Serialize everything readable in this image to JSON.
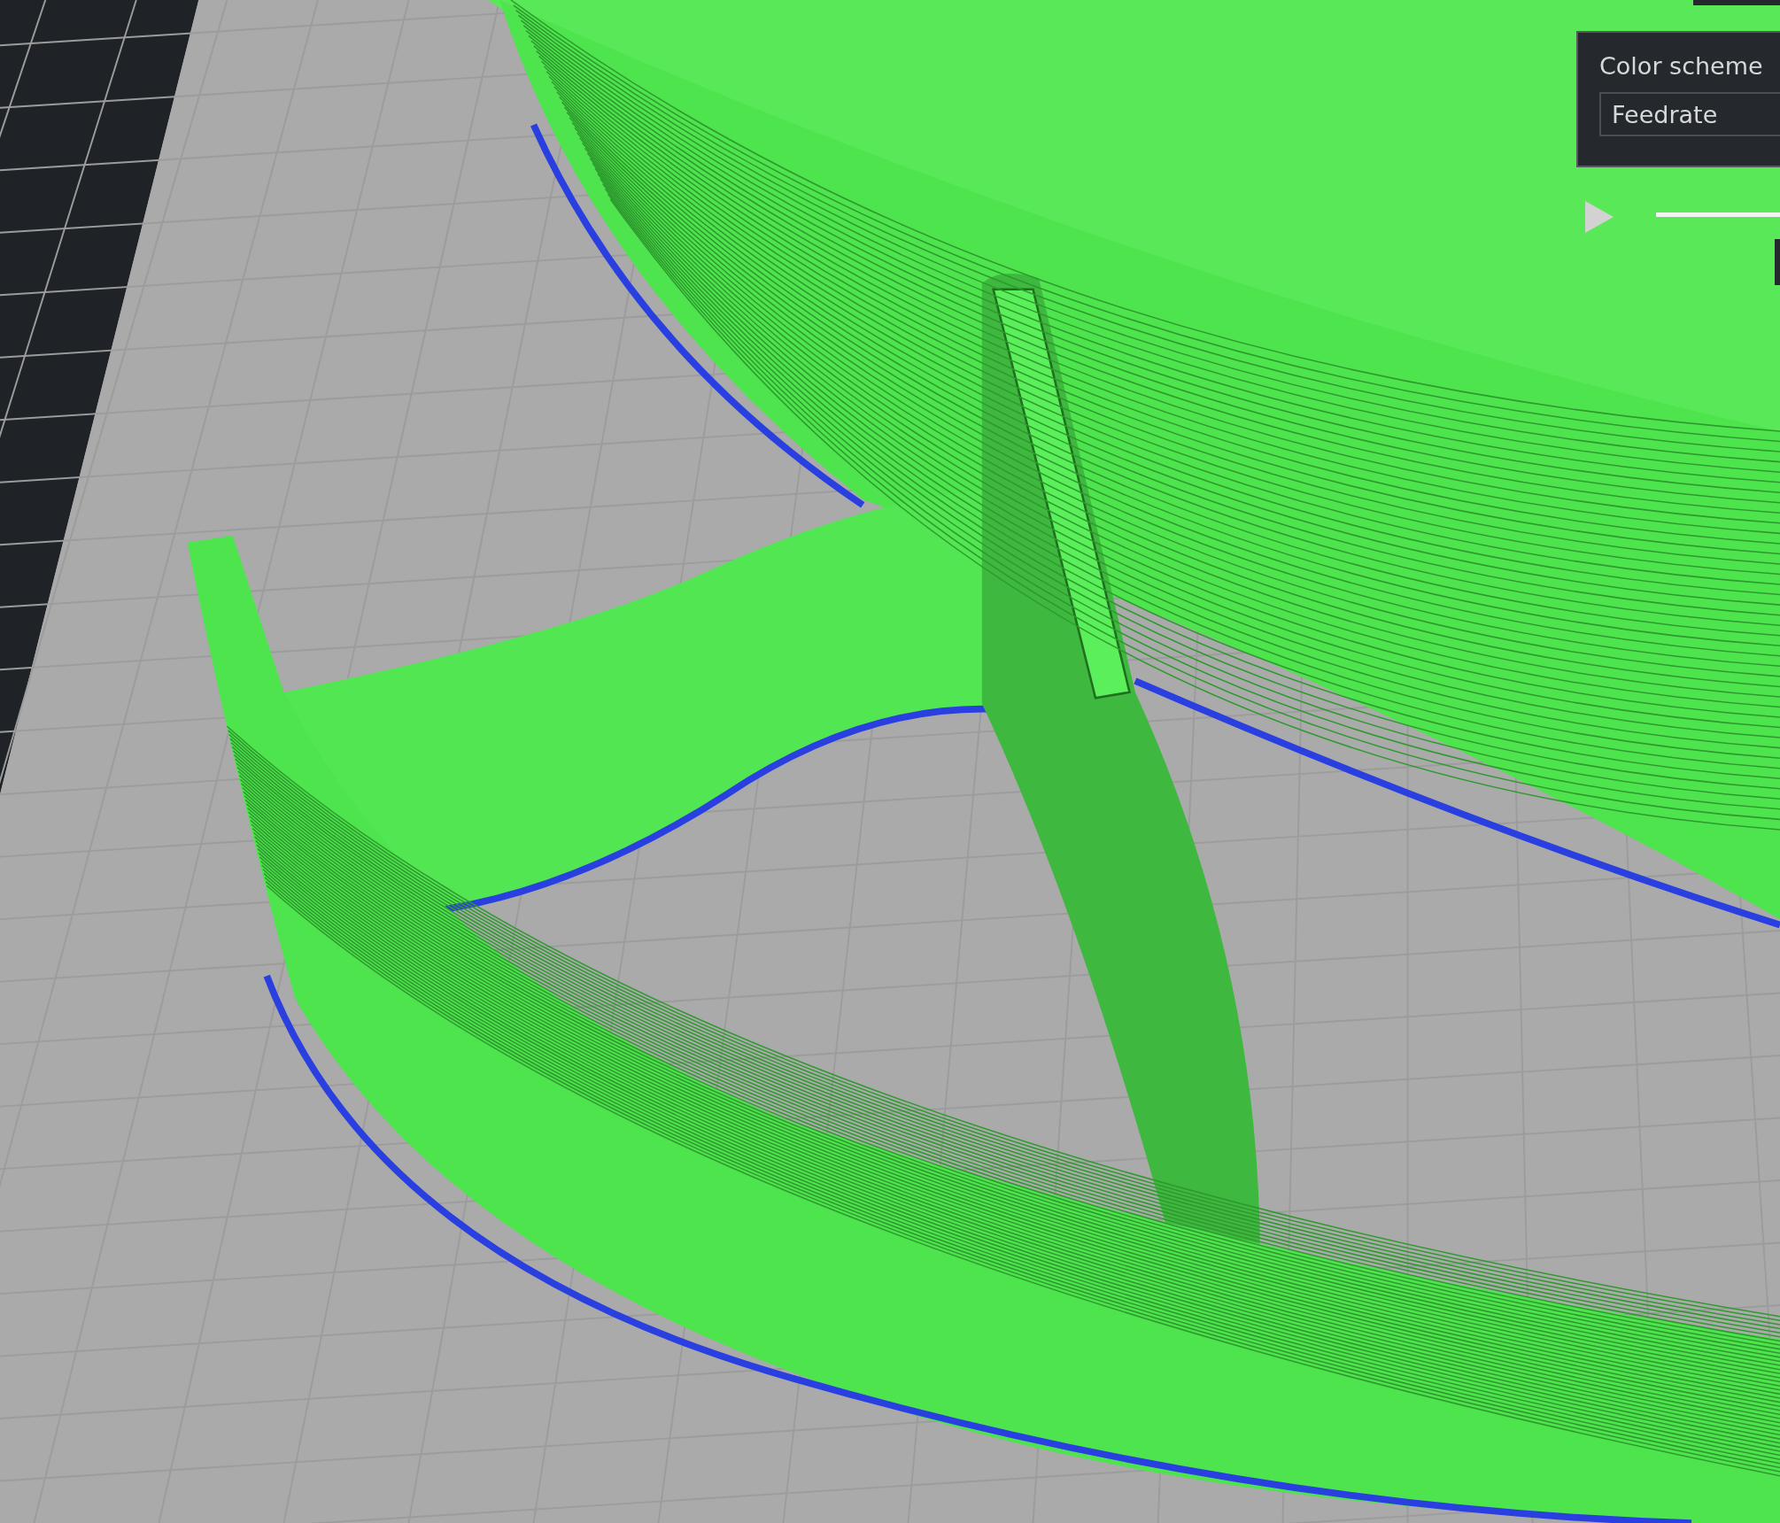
{
  "color_scheme": {
    "label": "Color scheme",
    "selected_option": "Feedrate"
  }
}
